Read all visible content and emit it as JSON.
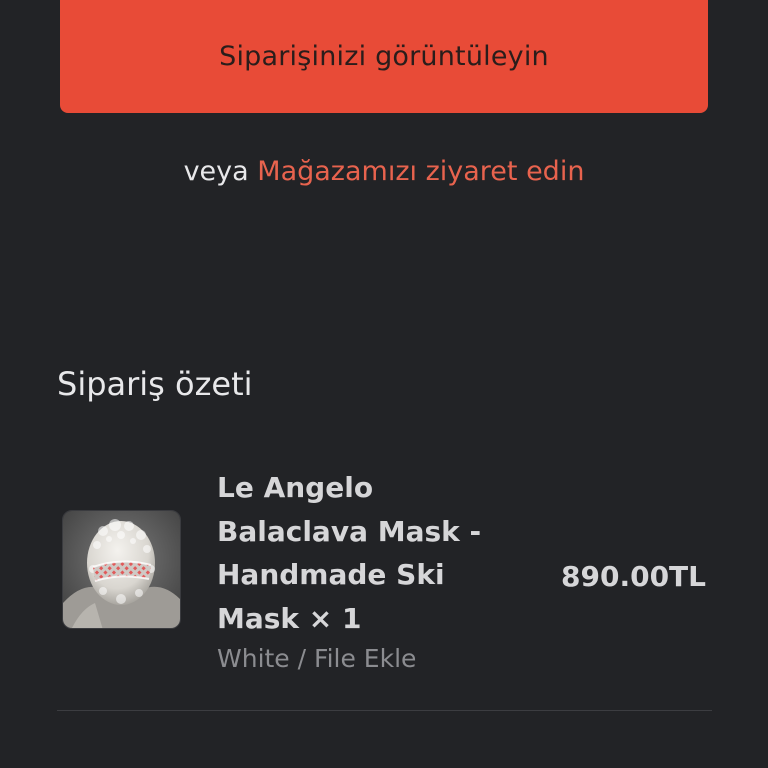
{
  "actions": {
    "view_order_label": "Siparişinizi görüntüleyin",
    "or_text": "veya",
    "visit_store_label": "Mağazamızı ziyaret edin"
  },
  "summary": {
    "title": "Sipariş özeti",
    "items": [
      {
        "name": "Le Angelo Balaclava Mask - Handmade Ski Mask × 1",
        "variant": "White / File Ekle",
        "price": "890.00TL"
      }
    ]
  },
  "colors": {
    "background": "#222326",
    "accent": "#e84b37",
    "link": "#e8634e"
  }
}
